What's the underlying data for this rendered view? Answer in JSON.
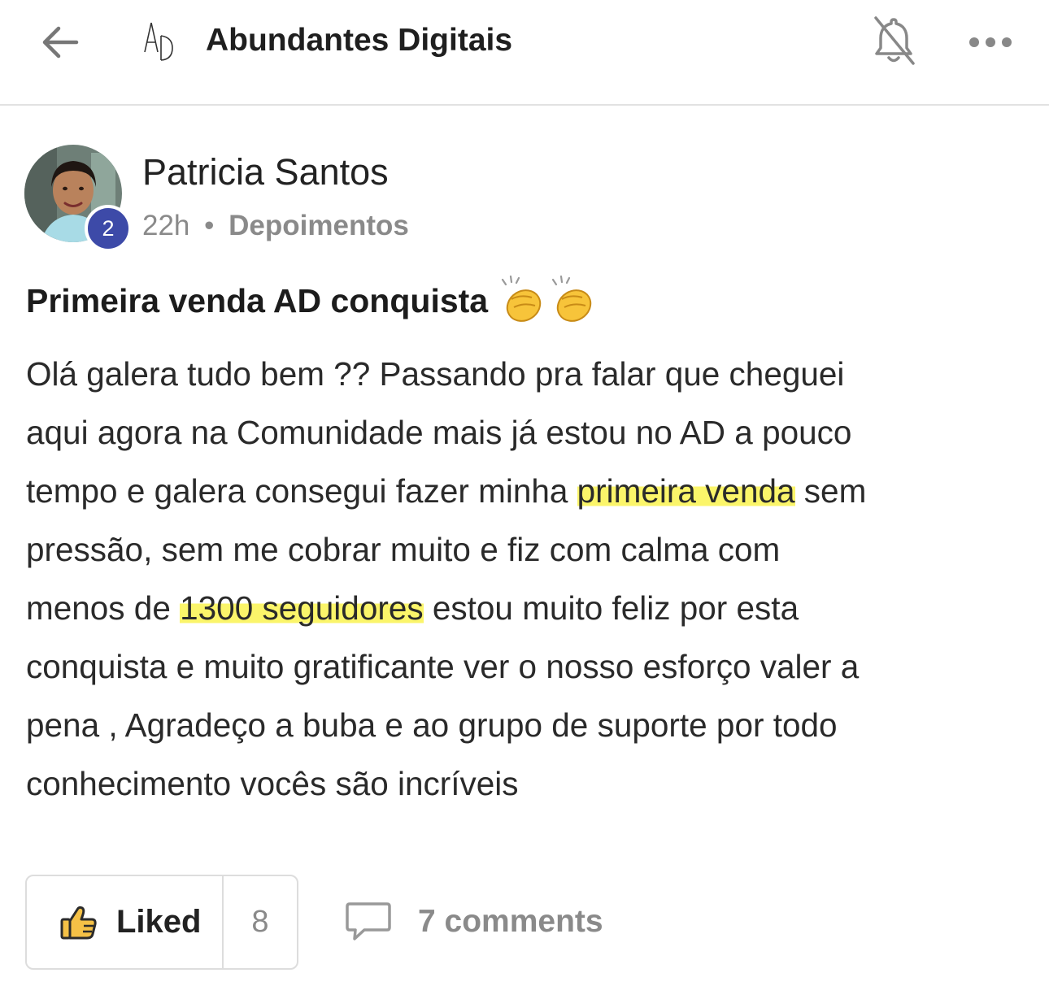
{
  "header": {
    "title": "Abundantes Digitais",
    "logo_text": "AD",
    "icons": {
      "back": "arrow-left-icon",
      "notifications": "bell-off-icon",
      "more": "more-horizontal-icon"
    }
  },
  "post": {
    "author": {
      "name": "Patricia Santos",
      "level": "2"
    },
    "time_ago": "22h",
    "separator": "•",
    "category": "Depoimentos",
    "title": "Primeira venda AD conquista",
    "title_emoji": "clapping-hands-emoji",
    "body_lines": [
      {
        "before": "Olá galera tudo bem ?? Passando pra falar que cheguei",
        "highlight": "",
        "after": ""
      },
      {
        "before": "aqui agora na Comunidade mais já estou no AD a pouco",
        "highlight": "",
        "after": ""
      },
      {
        "before": "tempo e galera consegui fazer minha ",
        "highlight": "primeira venda",
        "after": " sem"
      },
      {
        "before": "pressão, sem me cobrar muito e fiz com calma com",
        "highlight": "",
        "after": ""
      },
      {
        "before": "menos de ",
        "highlight": "1300 seguidores",
        "after": " estou muito feliz por esta"
      },
      {
        "before": "conquista e muito gratificante ver o nosso esforço valer a",
        "highlight": "",
        "after": ""
      },
      {
        "before": "pena , Agradeço a buba e ao grupo de suporte por todo",
        "highlight": "",
        "after": ""
      },
      {
        "before": "conhecimento vocês são incríveis",
        "highlight": "",
        "after": ""
      }
    ],
    "highlight_color": "#fbf56a"
  },
  "actions": {
    "like_label": "Liked",
    "like_count": "8",
    "comments_label": "7 comments"
  },
  "colors": {
    "badge": "#3d4aa8",
    "muted_text": "#8a8a8a",
    "divider": "#e2e2e2"
  }
}
